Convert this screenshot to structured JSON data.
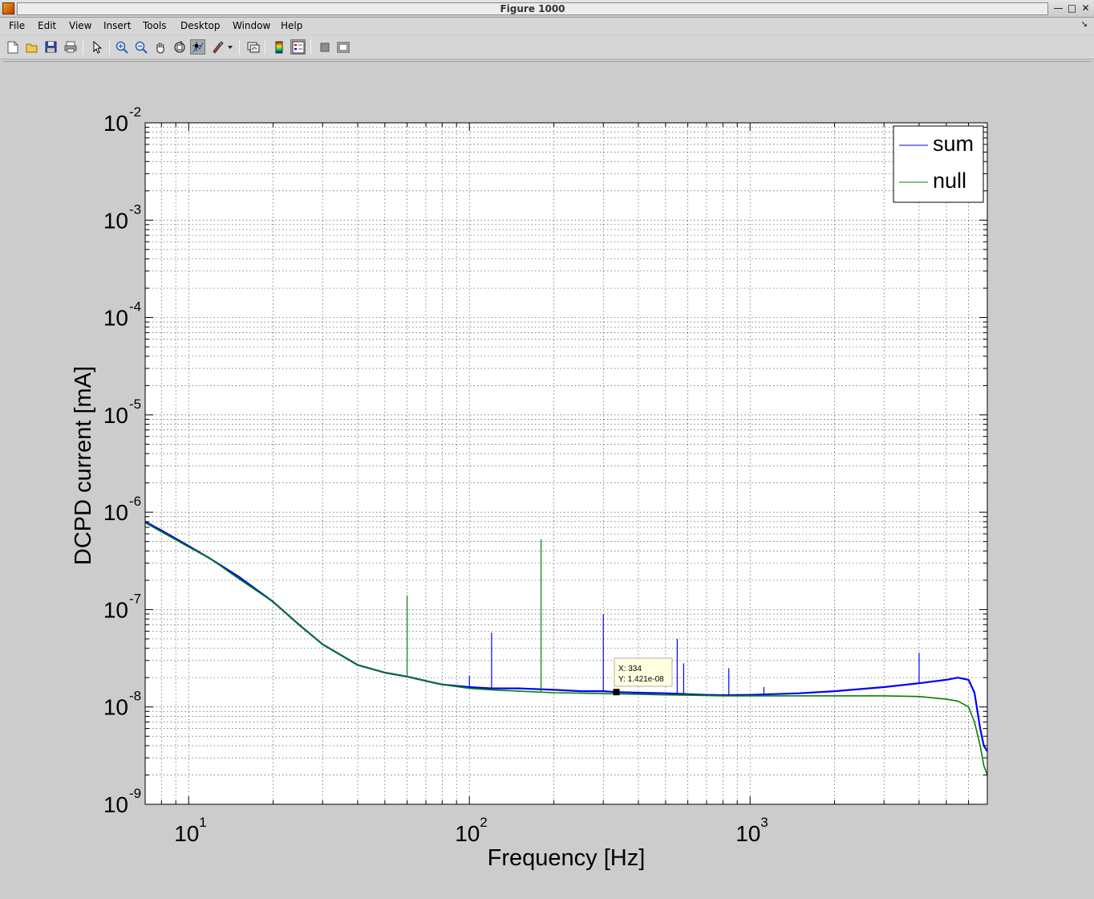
{
  "window": {
    "title": "Figure 1000"
  },
  "menu": [
    "File",
    "Edit",
    "View",
    "Insert",
    "Tools",
    "Desktop",
    "Window",
    "Help"
  ],
  "toolbar": {
    "icons": [
      "new-figure-icon",
      "open-file-icon",
      "save-icon",
      "print-icon",
      "edit-plot-icon",
      "zoom-in-icon",
      "zoom-out-icon",
      "pan-icon",
      "rotate-3d-icon",
      "data-cursor-icon",
      "brush-icon",
      "link-plot-icon",
      "colorbar-icon",
      "legend-icon",
      "hide-plot-tools-icon",
      "show-plot-tools-icon"
    ]
  },
  "chart_data": {
    "type": "line",
    "xscale": "log",
    "yscale": "log",
    "xlim": [
      7,
      7000
    ],
    "ylim": [
      1e-09,
      0.01
    ],
    "xlabel": "Frequency [Hz]",
    "ylabel": "DCPD current [mA]",
    "grid": true,
    "legend_position": "top-right",
    "x_ticks": [
      {
        "base": "10",
        "exp": "1",
        "value": 10
      },
      {
        "base": "10",
        "exp": "2",
        "value": 100
      },
      {
        "base": "10",
        "exp": "3",
        "value": 1000
      }
    ],
    "y_ticks": [
      {
        "base": "10",
        "exp": "-9",
        "value": 1e-09
      },
      {
        "base": "10",
        "exp": "-8",
        "value": 1e-08
      },
      {
        "base": "10",
        "exp": "-7",
        "value": 1e-07
      },
      {
        "base": "10",
        "exp": "-6",
        "value": 1e-06
      },
      {
        "base": "10",
        "exp": "-5",
        "value": 1e-05
      },
      {
        "base": "10",
        "exp": "-4",
        "value": 0.0001
      },
      {
        "base": "10",
        "exp": "-3",
        "value": 0.001
      },
      {
        "base": "10",
        "exp": "-2",
        "value": 0.01
      }
    ],
    "series": [
      {
        "name": "sum",
        "color": "#0000ff",
        "x": [
          7,
          8,
          10,
          12,
          15,
          20,
          25,
          30,
          40,
          50,
          60,
          70,
          80,
          100,
          120,
          150,
          200,
          250,
          300,
          334,
          400,
          500,
          600,
          700,
          800,
          1000,
          1500,
          2000,
          3000,
          4000,
          5000,
          5500,
          6000,
          6300,
          6600,
          6800,
          7000
        ],
        "y": [
          8e-07,
          6.5e-07,
          4.5e-07,
          3.3e-07,
          2.2e-07,
          1.2e-07,
          6.8e-08,
          4.4e-08,
          2.7e-08,
          2.25e-08,
          2.05e-08,
          1.85e-08,
          1.7e-08,
          1.6e-08,
          1.55e-08,
          1.55e-08,
          1.5e-08,
          1.45e-08,
          1.45e-08,
          1.421e-08,
          1.4e-08,
          1.38e-08,
          1.35e-08,
          1.33e-08,
          1.32e-08,
          1.33e-08,
          1.38e-08,
          1.45e-08,
          1.6e-08,
          1.75e-08,
          1.9e-08,
          2e-08,
          1.9e-08,
          1.4e-08,
          6e-09,
          4e-09,
          3.5e-09
        ]
      },
      {
        "name": "null",
        "color": "#008000",
        "x": [
          7,
          8,
          10,
          12,
          15,
          20,
          25,
          30,
          40,
          50,
          60,
          70,
          80,
          100,
          120,
          150,
          200,
          300,
          400,
          500,
          600,
          800,
          1000,
          1500,
          2000,
          3000,
          4000,
          5000,
          5500,
          6000,
          6300,
          6600,
          6800,
          7000
        ],
        "y": [
          7.8e-07,
          6.3e-07,
          4.4e-07,
          3.3e-07,
          2.1e-07,
          1.2e-07,
          6.8e-08,
          4.4e-08,
          2.7e-08,
          2.25e-08,
          2.05e-08,
          1.85e-08,
          1.7e-08,
          1.55e-08,
          1.5e-08,
          1.45e-08,
          1.4e-08,
          1.37e-08,
          1.35e-08,
          1.33e-08,
          1.32e-08,
          1.3e-08,
          1.3e-08,
          1.3e-08,
          1.3e-08,
          1.3e-08,
          1.28e-08,
          1.2e-08,
          1.15e-08,
          1e-08,
          7e-09,
          4e-09,
          2.5e-09,
          2e-09
        ]
      }
    ],
    "spikes": [
      {
        "series": "null",
        "x": 60,
        "y": 1.4e-07
      },
      {
        "series": "sum",
        "x": 100,
        "y": 2.1e-08
      },
      {
        "series": "sum",
        "x": 120,
        "y": 5.8e-08
      },
      {
        "series": "null",
        "x": 180,
        "y": 5.3e-07
      },
      {
        "series": "sum",
        "x": 300,
        "y": 9e-08
      },
      {
        "series": "sum",
        "x": 550,
        "y": 5e-08
      },
      {
        "series": "sum",
        "x": 580,
        "y": 2.8e-08
      },
      {
        "series": "sum",
        "x": 840,
        "y": 2.5e-08
      },
      {
        "series": "sum",
        "x": 1120,
        "y": 1.6e-08
      },
      {
        "series": "sum",
        "x": 4000,
        "y": 3.6e-08
      }
    ],
    "datatip": {
      "x": 334,
      "y": 1.421e-08,
      "x_text": "X: 334",
      "y_text": "Y: 1.421e-08"
    }
  }
}
